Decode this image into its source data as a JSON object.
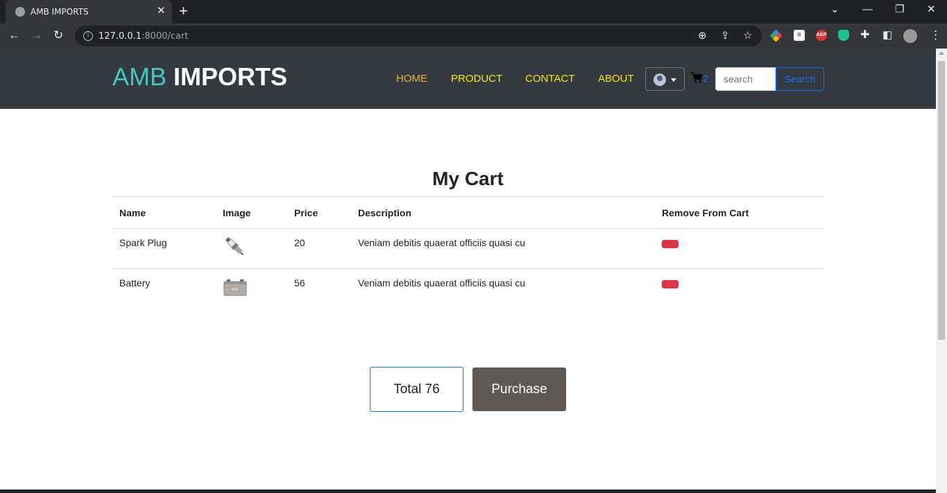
{
  "browser": {
    "tab_title": "AMB IMPORTS",
    "url_host": "127.0.0.1",
    "url_rest": ":8000/cart",
    "extensions": [
      "B",
      "ABP"
    ]
  },
  "navbar": {
    "brand_part1": "AMB",
    "brand_part2": "IMPORTS",
    "links": [
      "HOME",
      "PRODUCT",
      "CONTACT",
      "ABOUT"
    ],
    "cart_count": "2",
    "search_placeholder": "search",
    "search_button": "Search"
  },
  "cart": {
    "title": "My Cart",
    "headers": [
      "Name",
      "Image",
      "Price",
      "Description",
      "Remove From Cart"
    ],
    "rows": [
      {
        "name": "Spark Plug",
        "image": "spark-plug-image",
        "price": "20",
        "description": "Veniam debitis quaerat officiis quasi cu"
      },
      {
        "name": "Battery",
        "image": "battery-image",
        "price": "56",
        "description": "Veniam debitis quaerat officiis quasi cu"
      }
    ]
  },
  "summary": {
    "total_label": "Total 76",
    "purchase_label": "Purchase"
  },
  "colors": {
    "navbar_bg": "#343a40",
    "brand_accent": "#40c9c0",
    "nav_link": "#f5e900",
    "nav_active": "#f0b03c",
    "remove_button": "#dc3545",
    "purchase_button": "#5f5955",
    "primary": "#0d6efd"
  }
}
